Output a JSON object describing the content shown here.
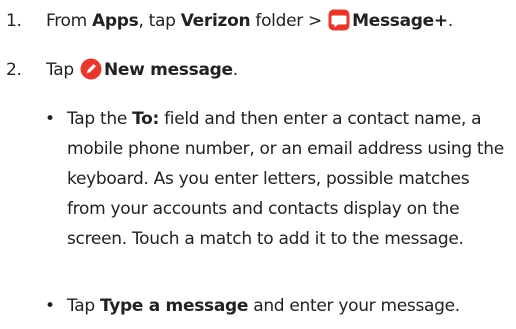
{
  "steps": [
    {
      "number": "1.",
      "text_before": "From ",
      "apps": "Apps",
      "text_middle": ", tap ",
      "folder_name": "Verizon",
      "text_after": " folder > ",
      "app_name": "Message+",
      "end": ".",
      "icon": "message-plus-app-icon",
      "icon_color": "#e8372c"
    },
    {
      "number": "2.",
      "text_before": "Tap ",
      "action": "New message",
      "end": ".",
      "icon": "new-message-pencil-icon",
      "icon_color": "#e8372c"
    }
  ],
  "bullets": [
    {
      "marker": "•",
      "before": "Tap the ",
      "field": "To:",
      "after": " field and then enter a contact name, a mobile phone number, or an email address using the keyboard. As you enter letters, possible matches from your accounts and contacts display on the screen. Touch a match to add it to the message."
    },
    {
      "marker": "•",
      "before": "Tap ",
      "field": "Type a message",
      "after": " and enter your message."
    }
  ]
}
